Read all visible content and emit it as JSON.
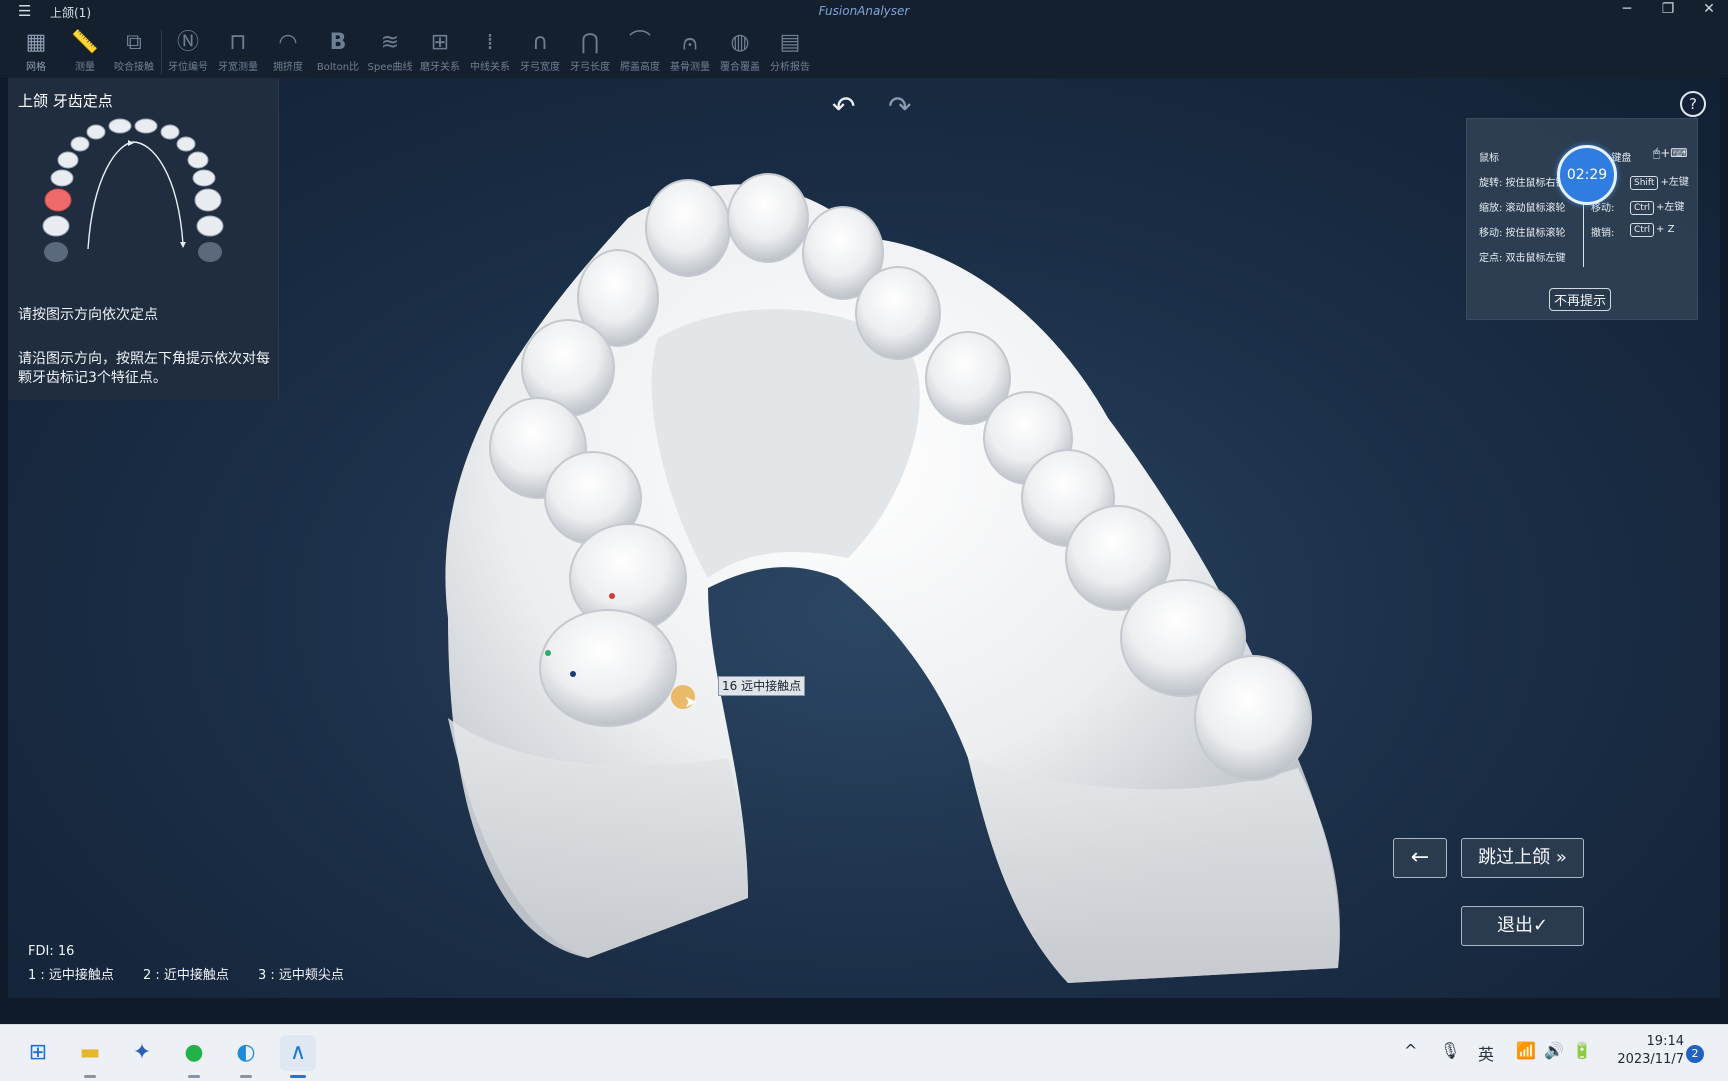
{
  "titlebar": {
    "menu_icon": "hamburger-icon",
    "doc_title": "上颌(1)",
    "app_title": "FusionAnalyser"
  },
  "toolbar": {
    "tools": [
      {
        "label": "网格",
        "icon": "grid-icon"
      },
      {
        "label": "测量",
        "icon": "ruler-icon"
      },
      {
        "label": "咬合接触",
        "icon": "occlusion-icon"
      },
      {
        "label": "牙位编号",
        "icon": "number-icon"
      },
      {
        "label": "牙宽测量",
        "icon": "tooth-width-icon"
      },
      {
        "label": "拥挤度",
        "icon": "crowding-icon"
      },
      {
        "label": "Bolton比",
        "icon": "bolton-icon"
      },
      {
        "label": "Spee曲线",
        "icon": "spee-curve-icon"
      },
      {
        "label": "磨牙关系",
        "icon": "molar-icon"
      },
      {
        "label": "中线关系",
        "icon": "midline-icon"
      },
      {
        "label": "牙弓宽度",
        "icon": "arch-width-icon"
      },
      {
        "label": "牙弓长度",
        "icon": "arch-length-icon"
      },
      {
        "label": "腭盖高度",
        "icon": "palate-icon"
      },
      {
        "label": "基骨测量",
        "icon": "basal-bone-icon"
      },
      {
        "label": "覆合覆盖",
        "icon": "overbite-icon"
      },
      {
        "label": "分析报告",
        "icon": "report-icon"
      }
    ]
  },
  "panel": {
    "title": "上颌 牙齿定点",
    "instruction_title": "请按图示方向依次定点",
    "instruction_body": "请沿图示方向，按照左下角提示依次对每颗牙齿标记3个特征点。"
  },
  "hint": {
    "mouse_header": "鼠标",
    "kb_header": "+键盘",
    "rows": [
      {
        "left": "旋转: 按住鼠标右键",
        "right_label": "",
        "key": "Shift",
        "right_suffix": "+左键"
      },
      {
        "left": "缩放: 滚动鼠标滚轮",
        "right_label": "移动:",
        "key": "Ctrl",
        "right_suffix": "+左键"
      },
      {
        "left": "移动: 按住鼠标滚轮",
        "right_label": "撤销:",
        "key": "Ctrl",
        "right_suffix": "+ Z"
      },
      {
        "left": "定点: 双击鼠标左键",
        "right_label": "",
        "key": "",
        "right_suffix": ""
      }
    ],
    "dismiss": "不再提示",
    "timer": "02:29"
  },
  "viewport": {
    "tooltip": "16  远中接触点",
    "fdi": "FDI: 16",
    "points": [
      "1 : 远中接触点",
      "2 : 近中接触点",
      "3 : 远中颊尖点"
    ]
  },
  "buttons": {
    "back_icon": "arrow-left-icon",
    "skip": "跳过上颌 »",
    "exit": "退出✓"
  },
  "taskbar": {
    "apps": [
      "windows-start-icon",
      "file-explorer-icon",
      "app-icon",
      "wechat-icon",
      "edge-icon",
      "fusionanalyser-icon"
    ],
    "ime": "英",
    "time": "19:14",
    "date": "2023/11/7",
    "notifications": "2"
  },
  "colors": {
    "accent": "#2f7de1",
    "selected_tooth": "#ef6a6a",
    "background": "#1c3049"
  }
}
